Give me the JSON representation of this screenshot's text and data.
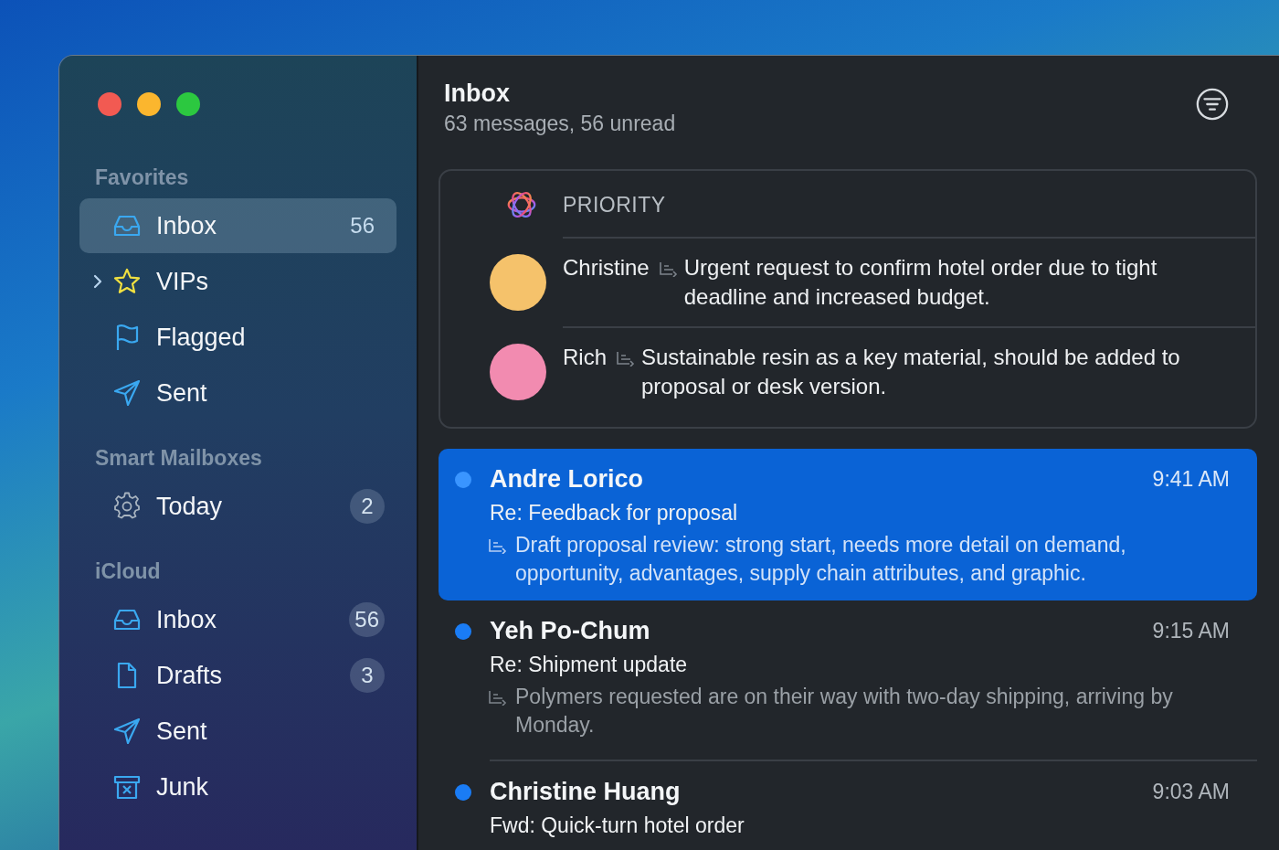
{
  "sidebar": {
    "sections": [
      {
        "title": "Favorites",
        "items": [
          {
            "kind": "inbox",
            "label": "Inbox",
            "count": "56",
            "selected": true
          },
          {
            "kind": "vips",
            "label": "VIPs",
            "expanded": false,
            "selected": false
          },
          {
            "kind": "flagged",
            "label": "Flagged",
            "selected": false
          },
          {
            "kind": "sent",
            "label": "Sent",
            "selected": false
          }
        ]
      },
      {
        "title": "Smart Mailboxes",
        "items": [
          {
            "kind": "smart",
            "label": "Today",
            "count": "2",
            "selected": false
          }
        ]
      },
      {
        "title": "iCloud",
        "items": [
          {
            "kind": "inbox",
            "label": "Inbox",
            "count": "56",
            "selected": false
          },
          {
            "kind": "drafts",
            "label": "Drafts",
            "count": "3",
            "selected": false
          },
          {
            "kind": "sent",
            "label": "Sent",
            "selected": false
          },
          {
            "kind": "junk",
            "label": "Junk",
            "selected": false
          }
        ]
      }
    ]
  },
  "header": {
    "title": "Inbox",
    "subtitle": "63 messages, 56 unread"
  },
  "priority": {
    "title": "PRIORITY",
    "items": [
      {
        "sender": "Christine",
        "summary": "Urgent request to confirm hotel order due to tight deadline and increased budget.",
        "color": "#f5c26b"
      },
      {
        "sender": "Rich",
        "summary": "Sustainable resin as a key material, should be added to proposal or desk version.",
        "color": "#f28bb0"
      }
    ]
  },
  "messages": [
    {
      "sender": "Andre Lorico",
      "time": "9:41 AM",
      "subject": "Re: Feedback for proposal",
      "preview": "Draft proposal review: strong start, needs more detail on demand, opportunity, advantages, supply chain attributes, and graphic.",
      "unread": true,
      "selected": true
    },
    {
      "sender": "Yeh Po-Chum",
      "time": "9:15 AM",
      "subject": "Re: Shipment update",
      "preview": "Polymers requested are on their way with two-day shipping, arriving by Monday.",
      "unread": true,
      "selected": false
    },
    {
      "sender": "Christine Huang",
      "time": "9:03 AM",
      "subject": "Fwd: Quick-turn hotel order",
      "unread": true,
      "selected": false
    }
  ]
}
